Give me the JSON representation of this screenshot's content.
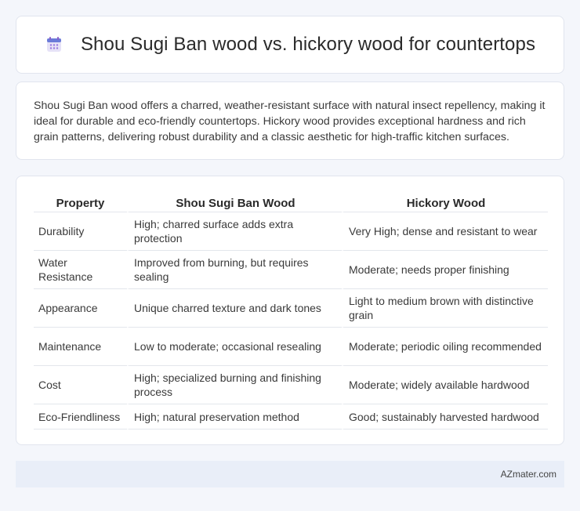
{
  "header": {
    "title": "Shou Sugi Ban wood vs. hickory wood for countertops",
    "icon": "calendar-icon"
  },
  "summary": {
    "text": "Shou Sugi Ban wood offers a charred, weather-resistant surface with natural insect repellency, making it ideal for durable and eco-friendly countertops. Hickory wood provides exceptional hardness and rich grain patterns, delivering robust durability and a classic aesthetic for high-traffic kitchen surfaces."
  },
  "table": {
    "headers": [
      "Property",
      "Shou Sugi Ban Wood",
      "Hickory Wood"
    ],
    "rows": [
      [
        "Durability",
        "High; charred surface adds extra protection",
        "Very High; dense and resistant to wear"
      ],
      [
        "Water Resistance",
        "Improved from burning, but requires sealing",
        "Moderate; needs proper finishing"
      ],
      [
        "Appearance",
        "Unique charred texture and dark tones",
        "Light to medium brown with distinctive grain"
      ],
      [
        "Maintenance",
        "Low to moderate; occasional resealing",
        "Moderate; periodic oiling recommended"
      ],
      [
        "Cost",
        "High; specialized burning and finishing process",
        "Moderate; widely available hardwood"
      ],
      [
        "Eco-Friendliness",
        "High; natural preservation method",
        "Good; sustainably harvested hardwood"
      ]
    ]
  },
  "footer": {
    "text": "AZmater.com"
  },
  "colors": {
    "background": "#f4f6fb",
    "card": "#ffffff",
    "footer": "#e9eef8",
    "icon_accent": "#6b7bd9"
  }
}
